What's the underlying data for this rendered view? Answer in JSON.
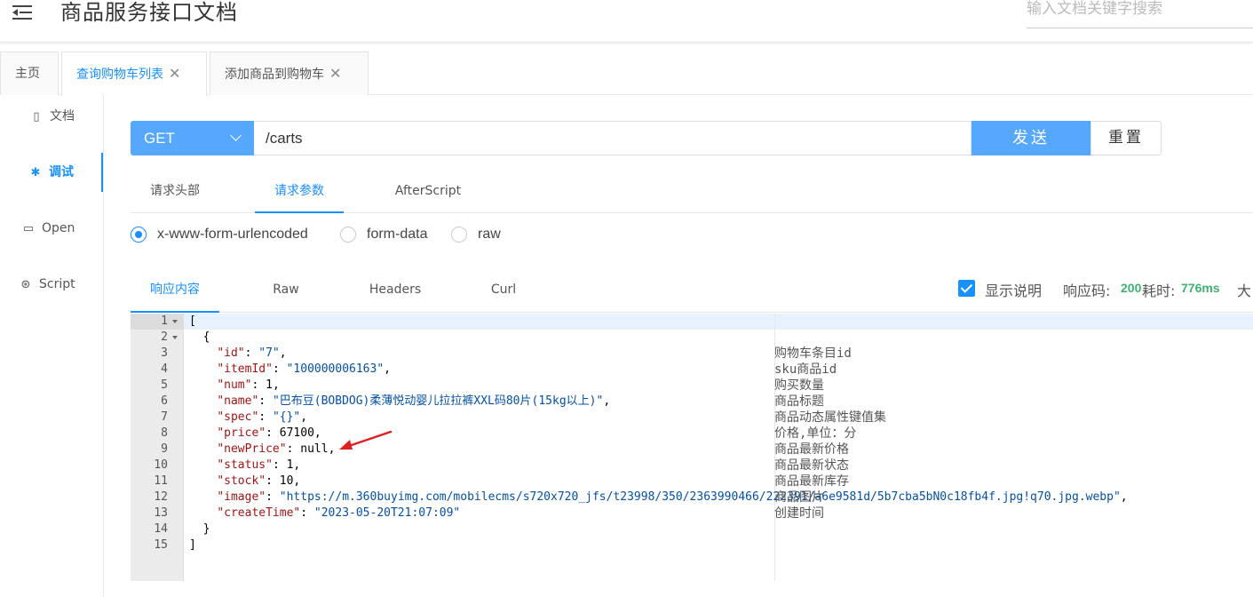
{
  "header": {
    "title": "商品服务接口文档",
    "search_placeholder": "输入文档关键字搜索"
  },
  "tabs": [
    {
      "label": "主页"
    },
    {
      "label": "查询购物车列表",
      "close": "✕"
    },
    {
      "label": "添加商品到购物车",
      "close": "✕"
    }
  ],
  "sidebar": {
    "items": [
      {
        "label": "文档",
        "icon": "document-icon"
      },
      {
        "label": "调试",
        "icon": "bug-icon"
      },
      {
        "label": "Open",
        "icon": "file-icon"
      },
      {
        "label": "Script",
        "icon": "code-icon"
      }
    ]
  },
  "request": {
    "method": "GET",
    "url": "/carts",
    "send_label": "发送",
    "reset_label": "重置"
  },
  "sub_tabs": [
    "请求头部",
    "请求参数",
    "AfterScript"
  ],
  "body_types": [
    "x-www-form-urlencoded",
    "form-data",
    "raw"
  ],
  "response": {
    "tabs": [
      "响应内容",
      "Raw",
      "Headers",
      "Curl"
    ],
    "show_desc_label": "显示说明",
    "status_label": "响应码:",
    "status_code": "200",
    "time_label": "耗时:",
    "time_value": "776ms",
    "size_label": "大"
  },
  "editor": {
    "line_numbers": [
      "1",
      "2",
      "3",
      "4",
      "5",
      "6",
      "7",
      "8",
      "9",
      "10",
      "11",
      "12",
      "13",
      "14",
      "15"
    ],
    "comments": {
      "id": "购物车条目id",
      "itemId": "sku商品id",
      "num": "购买数量",
      "name": "商品标题",
      "spec": "商品动态属性键值集",
      "price": "价格,单位：分",
      "newPrice": "商品最新价格",
      "status": "商品最新状态",
      "stock": "商品最新库存",
      "image": "商品图片",
      "createTime": "创建时间"
    },
    "values": {
      "id": "\"7\"",
      "itemId": "\"100000006163\"",
      "num": "1",
      "name": "\"巴布豆(BOBDOG)柔薄悦动婴儿拉拉裤XXL码80片(15kg以上)\"",
      "spec": "\"{}\"",
      "price": "67100",
      "newPrice": "null",
      "status": "1",
      "stock": "10",
      "image": "\"https://m.360buyimg.com/mobilecms/s720x720_jfs/t23998/350/2363990466/222391/a6e9581d/5b7cba5bN0c18fb4f.jpg!q70.jpg.webp\"",
      "createTime": "\"2023-05-20T21:07:09\""
    }
  },
  "colors": {
    "accent": "#1890ff",
    "button": "#55a8fd",
    "success": "#3cb371",
    "annotation_arrow": "#e02020"
  }
}
